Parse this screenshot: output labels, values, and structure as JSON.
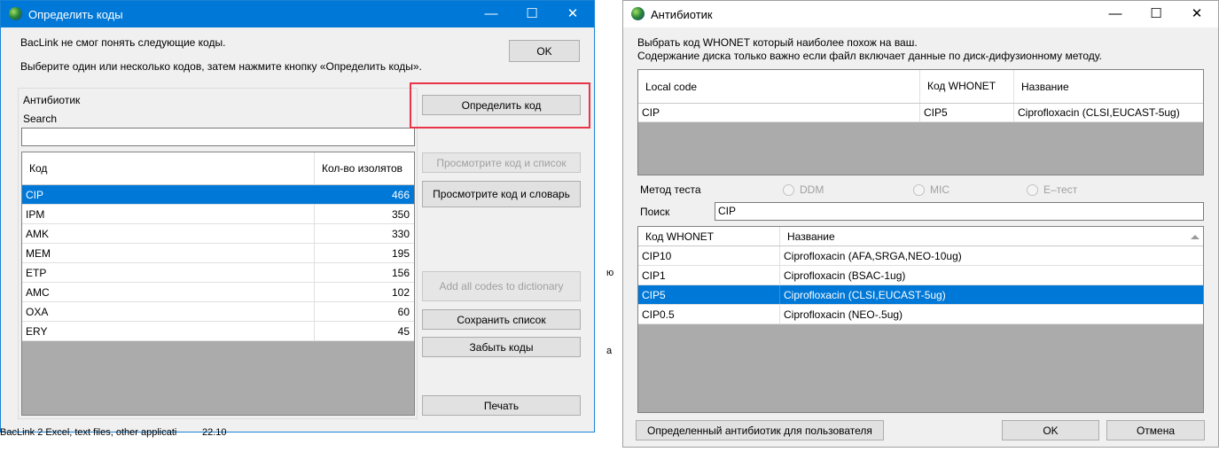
{
  "left_window": {
    "title": "Определить коды",
    "controls": {
      "minimize": "—",
      "maximize": "☐",
      "close": "✕"
    },
    "message1": "BacLink не смог понять следующие коды.",
    "message2": "Выберите один или несколько кодов, затем нажмите кнопку «Определить коды».",
    "ok_label": "OK",
    "group_label": "Антибиотик",
    "search_label": "Search",
    "search_value": "",
    "columns": [
      "Код",
      "Кол-во изолятов"
    ],
    "rows": [
      {
        "code": "CIP",
        "count": "466"
      },
      {
        "code": "IPM",
        "count": "350"
      },
      {
        "code": "AMK",
        "count": "330"
      },
      {
        "code": "MEM",
        "count": "195"
      },
      {
        "code": "ETP",
        "count": "156"
      },
      {
        "code": "AMC",
        "count": "102"
      },
      {
        "code": "OXA",
        "count": "60"
      },
      {
        "code": "ERY",
        "count": "45"
      }
    ],
    "buttons": {
      "define": "Определить код",
      "view_list": "Просмотрите код и список",
      "view_dict": "Просмотрите код и словарь",
      "add_all": "Add all codes to dictionary",
      "save_list": "Сохранить список",
      "forget": "Забыть коды",
      "print": "Печать"
    },
    "highlight_color": "#e8334a"
  },
  "background": {
    "taskbar_text": "BacLink 2 Excel, text files, other applicati",
    "taskbar_time": "22.10",
    "left_fragments": [
      "ю",
      "а"
    ]
  },
  "right_window": {
    "title": "Антибиотик",
    "controls": {
      "minimize": "—",
      "maximize": "☐",
      "close": "✕"
    },
    "instruction1": "Выбрать код WHONET который наиболее похож на ваш.",
    "instruction2": "Содержание диска только важно если файл включает данные по диск-дифузионному методу.",
    "top_columns": [
      "Local code",
      "Код WHONET",
      "Название"
    ],
    "top_row": {
      "local": "CIP",
      "whonet": "CIP5",
      "name": "Ciprofloxacin (CLSI,EUCAST-5ug)"
    },
    "method_label": "Метод теста",
    "methods": [
      "DDM",
      "MIC",
      "E–тест"
    ],
    "search_label": "Поиск",
    "search_value": "CIP",
    "bottom_columns": [
      "Код WHONET",
      "Название"
    ],
    "bottom_rows": [
      {
        "code": "CIP10",
        "name": "Ciprofloxacin (AFA,SRGA,NEO-10ug)"
      },
      {
        "code": "CIP1",
        "name": "Ciprofloxacin (BSAC-1ug)"
      },
      {
        "code": "CIP5",
        "name": "Ciprofloxacin (CLSI,EUCAST-5ug)"
      },
      {
        "code": "CIP0.5",
        "name": "Ciprofloxacin (NEO-.5ug)"
      }
    ],
    "btn_user": "Определенный антибиотик для пользователя",
    "btn_ok": "OK",
    "btn_cancel": "Отмена"
  }
}
